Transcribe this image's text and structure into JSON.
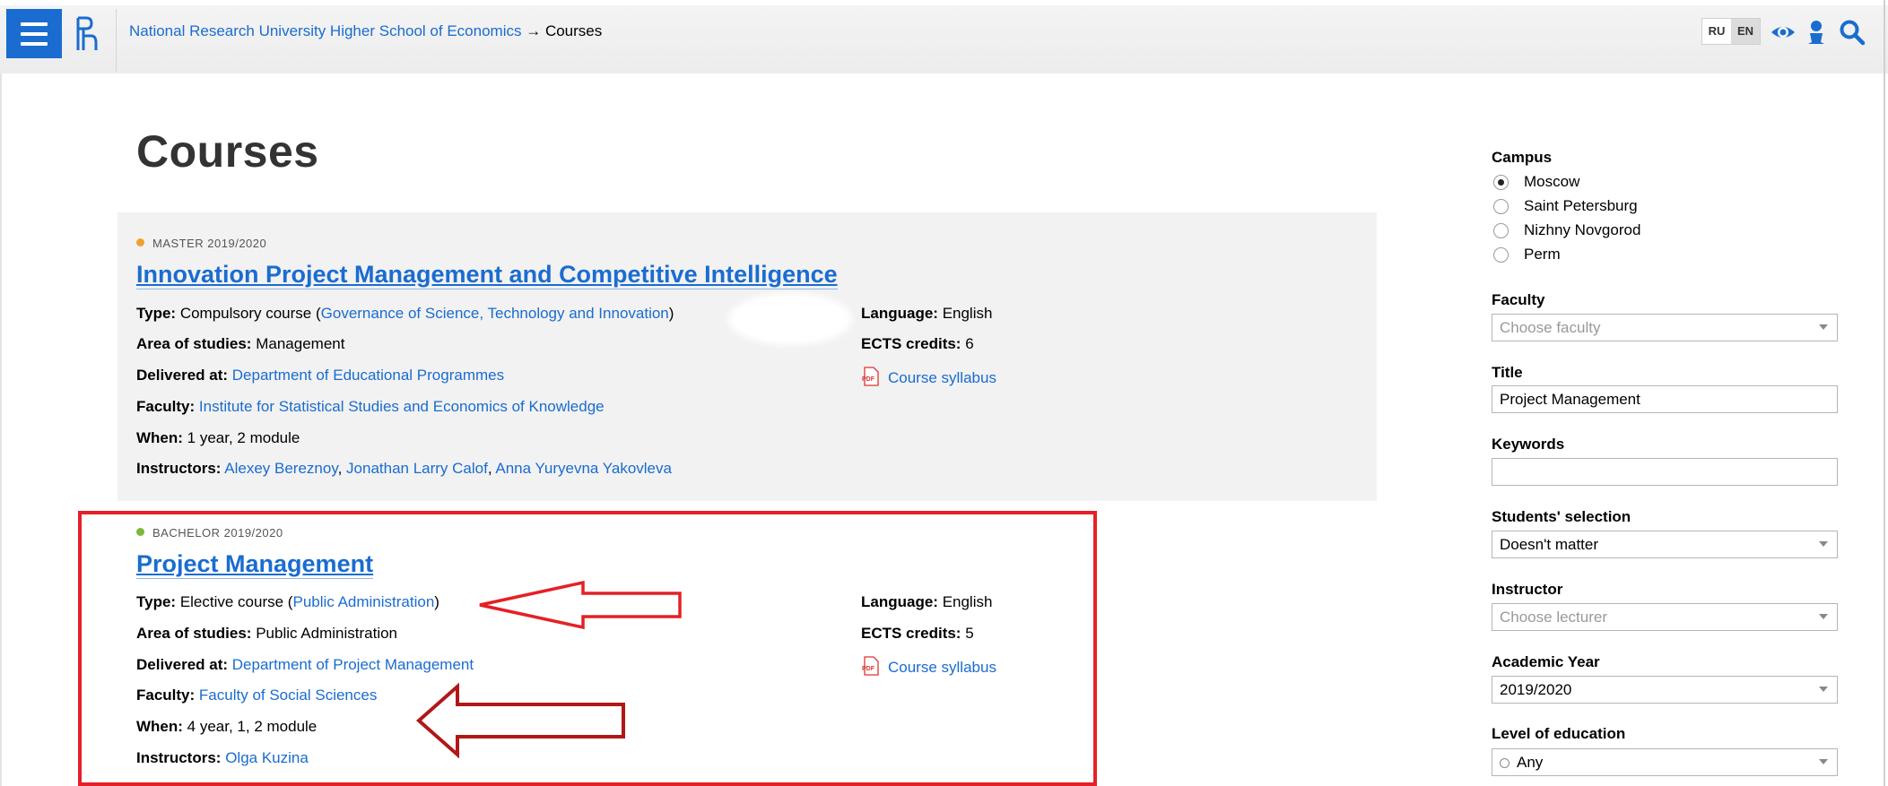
{
  "header": {
    "breadcrumb_parent": "National Research University Higher School of Economics",
    "breadcrumb_separator": "→",
    "breadcrumb_current": "Courses",
    "lang_ru": "RU",
    "lang_en": "EN",
    "icons": [
      "menu-icon",
      "hse-logo",
      "eye-icon",
      "user-icon",
      "search-icon"
    ],
    "accent_color": "#1a6cd0"
  },
  "page": {
    "title": "Courses"
  },
  "courses": [
    {
      "meta": "MASTER 2019/2020",
      "meta_dot_color": "#f0a030",
      "title": "Innovation Project Management and Competitive Intelligence",
      "type_label": "Type:",
      "type_value": "Compulsory course (",
      "type_link": "Governance of Science, Technology and Innovation",
      "type_close": ")",
      "area_label": "Area of studies:",
      "area_value": "Management",
      "delivered_label": "Delivered at:",
      "delivered_link": "Department of Educational Programmes",
      "faculty_label": "Faculty:",
      "faculty_link": "Institute for Statistical Studies and Economics of Knowledge",
      "when_label": "When:",
      "when_value": "1 year, 2 module",
      "instructors_label": "Instructors:",
      "instructors": [
        "Alexey Bereznoy",
        "Jonathan Larry Calof",
        "Anna Yuryevna Yakovleva"
      ],
      "language_label": "Language:",
      "language_value": "English",
      "ects_label": "ECTS credits:",
      "ects_value": "6",
      "syllabus": "Course syllabus"
    },
    {
      "meta": "BACHELOR 2019/2020",
      "meta_dot_color": "#7ab83a",
      "title": "Project Management",
      "type_label": "Type:",
      "type_value": "Elective course (",
      "type_link": "Public Administration",
      "type_close": ")",
      "area_label": "Area of studies:",
      "area_value": "Public Administration",
      "delivered_label": "Delivered at:",
      "delivered_link": "Department of Project Management",
      "faculty_label": "Faculty:",
      "faculty_link": "Faculty of Social Sciences",
      "when_label": "When:",
      "when_value": "4 year, 1, 2 module",
      "instructors_label": "Instructors:",
      "instructors": [
        "Olga Kuzina"
      ],
      "language_label": "Language:",
      "language_value": "English",
      "ects_label": "ECTS credits:",
      "ects_value": "5",
      "syllabus": "Course syllabus"
    }
  ],
  "annotation_color": "#e52026",
  "sidebar": {
    "campus_label": "Campus",
    "campus_options": [
      "Moscow",
      "Saint Petersburg",
      "Nizhny Novgorod",
      "Perm"
    ],
    "campus_selected": "Moscow",
    "faculty_label": "Faculty",
    "faculty_placeholder": "Choose faculty",
    "title_label": "Title",
    "title_value": "Project Management",
    "keywords_label": "Keywords",
    "keywords_value": "",
    "selection_label": "Students' selection",
    "selection_value": "Doesn't matter",
    "instructor_label": "Instructor",
    "instructor_placeholder": "Choose lecturer",
    "year_label": "Academic Year",
    "year_value": "2019/2020",
    "level_label": "Level of education",
    "level_value": "Any"
  }
}
